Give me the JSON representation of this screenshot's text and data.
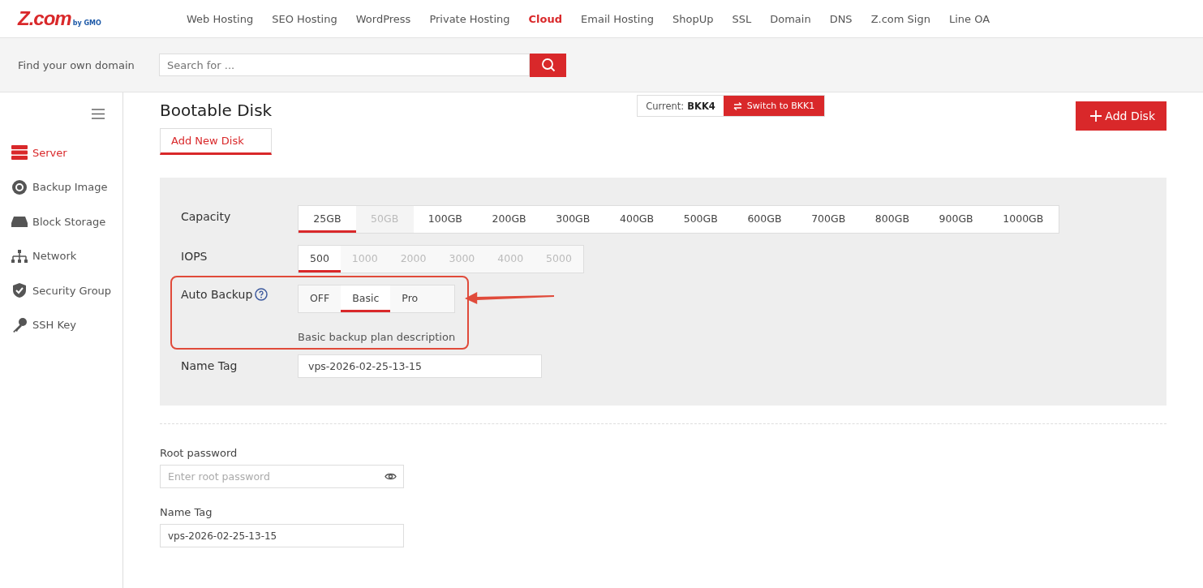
{
  "logo": {
    "brand": "Z.com",
    "sub": "by GMO"
  },
  "nav": [
    {
      "label": "Web Hosting",
      "selected": false
    },
    {
      "label": "SEO Hosting",
      "selected": false
    },
    {
      "label": "WordPress",
      "selected": false
    },
    {
      "label": "Private Hosting",
      "selected": false
    },
    {
      "label": "Cloud",
      "selected": true
    },
    {
      "label": "Email Hosting",
      "selected": false
    },
    {
      "label": "ShopUp",
      "selected": false
    },
    {
      "label": "SSL",
      "selected": false
    },
    {
      "label": "Domain",
      "selected": false
    },
    {
      "label": "DNS",
      "selected": false
    },
    {
      "label": "Z.com Sign",
      "selected": false
    },
    {
      "label": "Line OA",
      "selected": false
    }
  ],
  "domain_search": {
    "label": "Find your own domain",
    "placeholder": "Search for ..."
  },
  "sidebar": {
    "items": [
      {
        "label": "Server",
        "kind": "server",
        "selected": true
      },
      {
        "label": "Backup Image",
        "kind": "disc",
        "selected": false
      },
      {
        "label": "Block Storage",
        "kind": "drive",
        "selected": false
      },
      {
        "label": "Network",
        "kind": "network",
        "selected": false
      },
      {
        "label": "Security Group",
        "kind": "shield",
        "selected": false
      },
      {
        "label": "SSH Key",
        "kind": "key",
        "selected": false
      }
    ]
  },
  "page": {
    "title": "Bootable Disk",
    "tab": "Add New Disk",
    "region_label": "Current:",
    "region": "BKK4",
    "switch_button": "Switch to BKK1",
    "add_button": "Add Disk"
  },
  "form": {
    "capacity": {
      "label": "Capacity",
      "options": [
        {
          "label": "25GB",
          "selected": true,
          "disabled": false
        },
        {
          "label": "50GB",
          "selected": false,
          "disabled": true
        },
        {
          "label": "100GB",
          "selected": false,
          "disabled": false
        },
        {
          "label": "200GB",
          "selected": false,
          "disabled": false
        },
        {
          "label": "300GB",
          "selected": false,
          "disabled": false
        },
        {
          "label": "400GB",
          "selected": false,
          "disabled": false
        },
        {
          "label": "500GB",
          "selected": false,
          "disabled": false
        },
        {
          "label": "600GB",
          "selected": false,
          "disabled": false
        },
        {
          "label": "700GB",
          "selected": false,
          "disabled": false
        },
        {
          "label": "800GB",
          "selected": false,
          "disabled": false
        },
        {
          "label": "900GB",
          "selected": false,
          "disabled": false
        },
        {
          "label": "1000GB",
          "selected": false,
          "disabled": false
        }
      ]
    },
    "iops": {
      "label": "IOPS",
      "options": [
        {
          "label": "500",
          "selected": true,
          "disabled": false
        },
        {
          "label": "1000",
          "selected": false,
          "disabled": true
        },
        {
          "label": "2000",
          "selected": false,
          "disabled": true
        },
        {
          "label": "3000",
          "selected": false,
          "disabled": true
        },
        {
          "label": "4000",
          "selected": false,
          "disabled": true
        },
        {
          "label": "5000",
          "selected": false,
          "disabled": true
        }
      ]
    },
    "auto_backup": {
      "label": "Auto Backup",
      "options": [
        {
          "label": "OFF",
          "selected": false,
          "disabled": false
        },
        {
          "label": "Basic",
          "selected": true,
          "disabled": false
        },
        {
          "label": "Pro",
          "selected": false,
          "disabled": false
        }
      ],
      "description": "Basic backup plan description"
    },
    "name_tag": {
      "label": "Name Tag",
      "value": "vps-2026-02-25-13-15"
    }
  },
  "root_password": {
    "label": "Root password",
    "placeholder": "Enter root password"
  },
  "name_tag": {
    "label": "Name Tag",
    "value": "vps-2026-02-25-13-15"
  }
}
